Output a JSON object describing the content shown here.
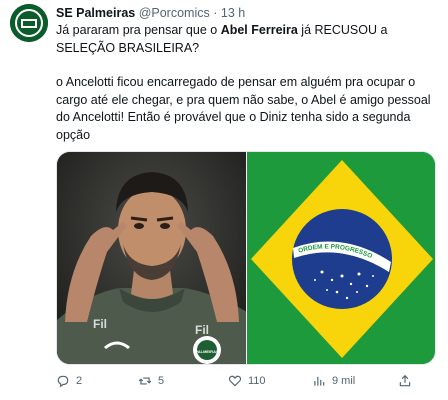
{
  "account": {
    "name": "SE Palmeiras",
    "handle": "@Porcomics",
    "separator": "·",
    "time": "13 h"
  },
  "tweet": {
    "line1_part1": "Já pararam pra pensar que o ",
    "line1_bold": "Abel Ferreira",
    "line1_part2": " já RECUSOU a SELEÇÃO BRASILEIRA?",
    "para2": "o Ancelotti ficou encarregado de pensar em alguém pra ocupar o cargo até ele chegar, e pra quem não sabe, o Abel é amigo pessoal do Ancelotti! Então é provável que o Diniz tenha sido a segunda opção",
    "plus": "+"
  },
  "media": {
    "jacket_text_left": "Fil",
    "jacket_text_right": "Fil",
    "club_badge_text": "PALMEIRAS",
    "flag_motto": "ORDEM E PROGRESSO"
  },
  "actions": {
    "replies": "2",
    "reposts": "5",
    "likes": "110",
    "views": "9 mil"
  }
}
